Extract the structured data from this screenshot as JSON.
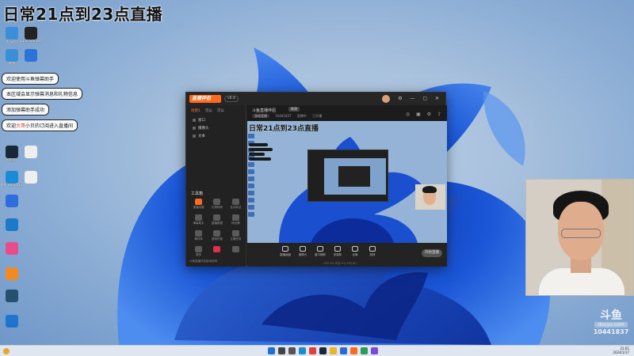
{
  "overlay": {
    "title": "日常21点到23点直播"
  },
  "desktop_icons": [
    {
      "label": "此电脑",
      "color": "#3a8fd8"
    },
    {
      "label": "Epic Games Launcher",
      "color": "#222222"
    },
    {
      "label": "网络",
      "color": "#3a8fd8"
    },
    {
      "label": "",
      "color": "#2b73d6"
    },
    {
      "label": "Microsoft Edge",
      "color": "#1b8bd6"
    },
    {
      "label": "",
      "color": "#2b73d6"
    },
    {
      "label": "",
      "color": "#2f6ce0"
    },
    {
      "label": "",
      "color": "#1c7ac8"
    },
    {
      "label": "",
      "color": "#e74c8b"
    },
    {
      "label": "",
      "color": "#f08a24"
    },
    {
      "label": "",
      "color": "#25506e"
    },
    {
      "label": "",
      "color": "#1f74d0"
    },
    {
      "label": "Steam",
      "color": "#1b2838"
    },
    {
      "label": "",
      "color": "#eeeeee"
    },
    {
      "label": "",
      "color": "#eeeeee"
    }
  ],
  "chat_messages": [
    {
      "pre": "欢迎使用斗鱼弹幕助手",
      "hl": "",
      "post": ""
    },
    {
      "pre": "本区域会显示弹幕消息和礼物信息",
      "hl": "",
      "post": ""
    },
    {
      "pre": "添加弹幕助手成功",
      "hl": "",
      "post": ""
    },
    {
      "pre": "欢迎",
      "hl": "大哥",
      "post": "小贝的订阅进入直播间"
    }
  ],
  "app": {
    "logo": "直播伴侣",
    "version": "v6.4",
    "window_controls": "⚙ — ▢ ✕",
    "left_tabs": [
      "场景1",
      "可以",
      "可以"
    ],
    "scenes": [
      "窗口",
      "摄像头",
      "文本"
    ],
    "tools_title": "工具箱",
    "tools": [
      {
        "label": "直播设置",
        "color": "#ff6a1e"
      },
      {
        "label": "礼物特效",
        "color": "#5a5a5a"
      },
      {
        "label": "互动玩法",
        "color": "#5a5a5a"
      },
      {
        "label": "弹幕助手",
        "color": "#5a5a5a"
      },
      {
        "label": "直播数据",
        "color": "#5a5a5a"
      },
      {
        "label": "粉丝牌",
        "color": "#5a5a5a"
      },
      {
        "label": "素材库",
        "color": "#5a5a5a"
      },
      {
        "label": "虚拟形象",
        "color": "#5a5a5a"
      },
      {
        "label": "主播任务",
        "color": "#5a5a5a"
      },
      {
        "label": "更多",
        "color": "#5a5a5a"
      },
      {
        "label": "",
        "color": "#e02e4f"
      },
      {
        "label": "",
        "color": "#5a5a5a"
      }
    ],
    "left_footer": "斗鱼直播伴侣使用说明",
    "room_title": "斗鱼直播伴侣",
    "room_edit": "修改",
    "room_meta": [
      "游戏直播",
      "10441837",
      "直播中",
      "已开播"
    ],
    "head_icons": "◎ ▣ ⚙ ⇪",
    "preview_title": "日常21点到23点直播",
    "bottom_items": [
      "直播画面",
      "摄像头",
      "窗口捕获",
      "多媒体",
      "全局",
      "音效"
    ],
    "start_button": "开始直播",
    "status_line": "CPU 0%  内存 0%  FPS 60"
  },
  "watermark": {
    "logo": "斗鱼",
    "sub": "douyu.com",
    "room_id": "10441837"
  },
  "taskbar": {
    "icons": [
      {
        "name": "windows",
        "color": "#1f6fd6"
      },
      {
        "name": "search",
        "color": "#444444"
      },
      {
        "name": "task-view",
        "color": "#555555"
      },
      {
        "name": "edge",
        "color": "#1b8bd6"
      },
      {
        "name": "chrome",
        "color": "#e0423a"
      },
      {
        "name": "steam",
        "color": "#1b2838"
      },
      {
        "name": "explorer",
        "color": "#e8b52c"
      },
      {
        "name": "app1",
        "color": "#2d6bd1"
      },
      {
        "name": "app2",
        "color": "#ff6a1e"
      },
      {
        "name": "app3",
        "color": "#2b9a5a"
      },
      {
        "name": "app4",
        "color": "#7c4ad6"
      }
    ],
    "time": "21:01",
    "date": "2024/1/17"
  }
}
